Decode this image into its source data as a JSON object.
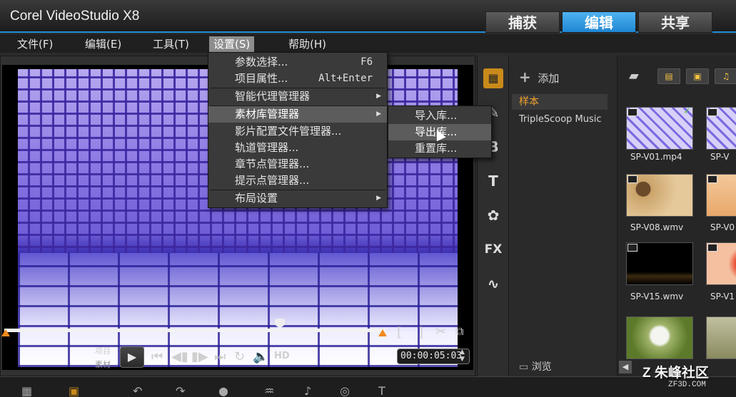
{
  "app": {
    "title": "Corel VideoStudio X8"
  },
  "mode_tabs": [
    {
      "label": "捕获",
      "active": false
    },
    {
      "label": "编辑",
      "active": true
    },
    {
      "label": "共享",
      "active": false
    }
  ],
  "menubar": [
    {
      "label": "文件(F)"
    },
    {
      "label": "编辑(E)"
    },
    {
      "label": "工具(T)"
    },
    {
      "label": "设置(S)",
      "open": true
    },
    {
      "label": "帮助(H)"
    }
  ],
  "settings_menu": {
    "items": [
      {
        "label": "参数选择...",
        "shortcut": "F6"
      },
      {
        "label": "项目属性...",
        "shortcut": "Alt+Enter"
      },
      {
        "label": "智能代理管理器",
        "submenu": true
      },
      {
        "label": "素材库管理器",
        "submenu": true,
        "highlighted": true
      },
      {
        "label": "影片配置文件管理器..."
      },
      {
        "label": "轨道管理器..."
      },
      {
        "label": "章节点管理器..."
      },
      {
        "label": "提示点管理器..."
      },
      {
        "label": "布局设置",
        "submenu": true
      }
    ]
  },
  "library_submenu": {
    "items": [
      {
        "label": "导入库..."
      },
      {
        "label": "导出库...",
        "highlighted": true
      },
      {
        "label": "重置库..."
      }
    ]
  },
  "player": {
    "project_label": "项目",
    "clip_label": "素材",
    "hd_label": "HD",
    "timecode": "00:00:05:03"
  },
  "library": {
    "add_label": "添加",
    "folders": [
      {
        "label": "样本",
        "selected": true
      },
      {
        "label": "TripleScoop Music"
      }
    ],
    "browse_label": "浏览",
    "thumbnails": [
      {
        "label": "SP-V01.mp4"
      },
      {
        "label": "SP-V08.wmv"
      },
      {
        "label": "SP-V15.wmv"
      },
      {
        "label": ""
      }
    ],
    "thumbnails_col2": [
      {
        "label": "SP-V"
      },
      {
        "label": "SP-V0"
      },
      {
        "label": "SP-V1"
      },
      {
        "label": ""
      }
    ]
  },
  "watermark": {
    "text": "朱峰社区",
    "url": "ZF3D.COM"
  },
  "colors": {
    "accent": "#1e8fd8",
    "active_tab": "#2a93de",
    "trim_marker": "#f08a1c",
    "folder_selected": "#f0a030"
  }
}
